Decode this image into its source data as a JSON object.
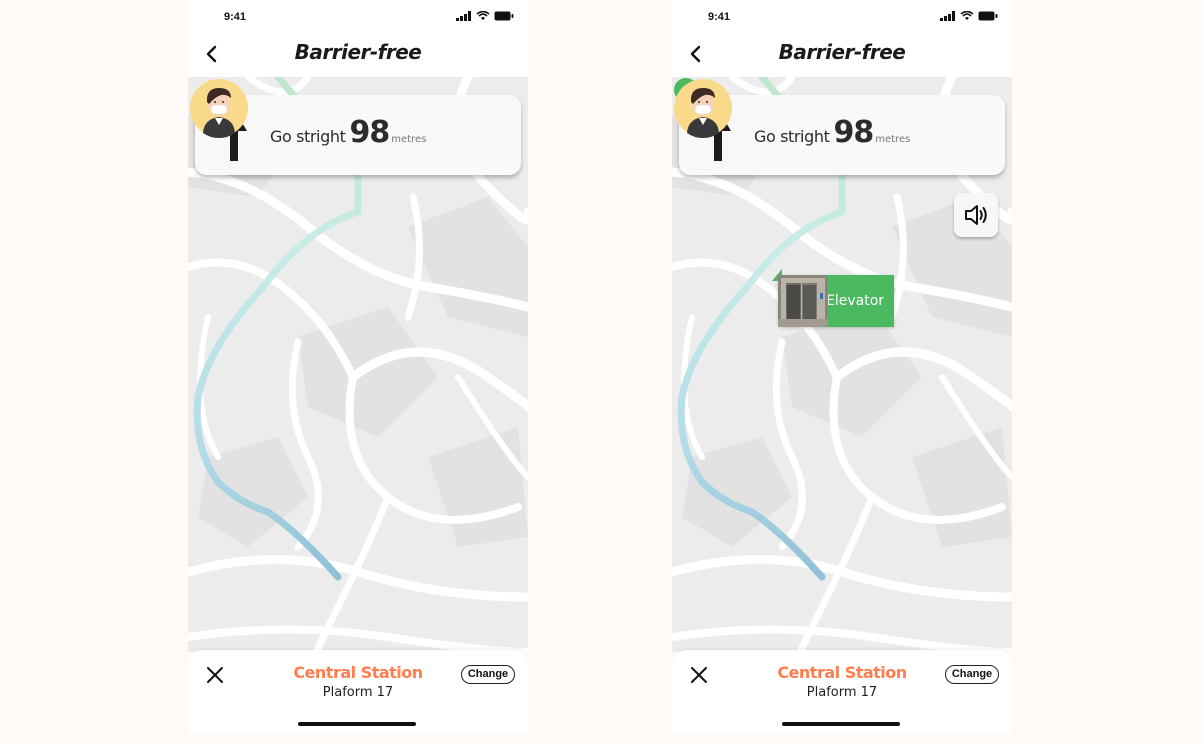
{
  "screens": [
    {
      "status": {
        "time": "9:41"
      },
      "header": {
        "title": "Barrier-free"
      },
      "instruction": {
        "text": "Go stright",
        "distance": "98",
        "unit": "metres"
      },
      "destination": {
        "name": "Central Station",
        "platform": "Plaform 17",
        "change_label": "Change"
      }
    },
    {
      "status": {
        "time": "9:41"
      },
      "header": {
        "title": "Barrier-free"
      },
      "instruction": {
        "text": "Go stright",
        "distance": "98",
        "unit": "metres"
      },
      "poi": {
        "label": "Elevator"
      },
      "destination": {
        "name": "Central Station",
        "platform": "Plaform 17",
        "change_label": "Change"
      }
    }
  ],
  "colors": {
    "accent_orange": "#ff7e4f",
    "poi_green": "#4cb85f",
    "route_green": "#bfe6cd",
    "route_blue": "#9cc9dc"
  },
  "icons": [
    "back-chevron-icon",
    "up-arrow-icon",
    "sound-icon",
    "location-pin-icon",
    "elevator-icon",
    "close-icon",
    "signal-icon",
    "wifi-icon",
    "battery-icon"
  ]
}
